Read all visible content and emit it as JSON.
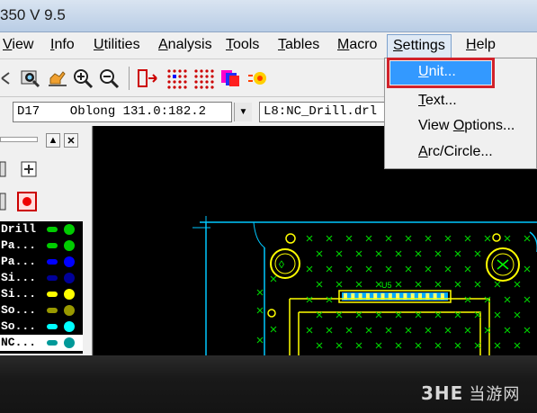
{
  "window": {
    "title": "350 V 9.5"
  },
  "menubar": {
    "items": [
      {
        "label": "View",
        "underline": "V",
        "rest": "iew"
      },
      {
        "label": "Info",
        "underline": "I",
        "rest": "nfo"
      },
      {
        "label": "Utilities",
        "underline": "U",
        "rest": "tilities"
      },
      {
        "label": "Analysis",
        "underline": "A",
        "rest": "nalysis"
      },
      {
        "label": "Tools",
        "underline": "T",
        "rest": "ools"
      },
      {
        "label": "Tables",
        "underline": "T",
        "rest": "ables"
      },
      {
        "label": "Macro",
        "underline": "M",
        "rest": "acro"
      },
      {
        "label": "Settings",
        "underline": "S",
        "rest": "ettings"
      },
      {
        "label": "Help",
        "underline": "H",
        "rest": "elp"
      }
    ]
  },
  "selection": {
    "dcode_value": "D17    Oblong 131.0:182.2",
    "layer_value": "L8:NC_Drill.drl"
  },
  "layers": [
    {
      "name": "Drill",
      "color": "#00cc00"
    },
    {
      "name": "Pa...",
      "color": "#00cc00"
    },
    {
      "name": "Pa...",
      "color": "#0000ff"
    },
    {
      "name": "Si...",
      "color": "#000099"
    },
    {
      "name": "Si...",
      "color": "#ffff00"
    },
    {
      "name": "So...",
      "color": "#999900"
    },
    {
      "name": "So...",
      "color": "#00ffff"
    },
    {
      "name": "NC...",
      "color": "#009999"
    }
  ],
  "settings_menu": {
    "items": [
      {
        "label": "Unit...",
        "underline": "U",
        "rest": "nit..."
      },
      {
        "label": "Text...",
        "underline": "T",
        "rest": "ext..."
      },
      {
        "label": "View Options...",
        "prefix": "View ",
        "underline": "O",
        "rest": "ptions..."
      },
      {
        "label": "Arc/Circle...",
        "underline": "A",
        "rest": "rc/Circle..."
      }
    ]
  },
  "canvas": {
    "component_label": "U5"
  },
  "watermark": {
    "logo": "3HE",
    "text": "当游网"
  },
  "colors": {
    "pcb_outline": "#00c8ff",
    "pad_cross": "#00cc00",
    "highlight": "#d1222b",
    "menu_hover": "#3399ff"
  }
}
